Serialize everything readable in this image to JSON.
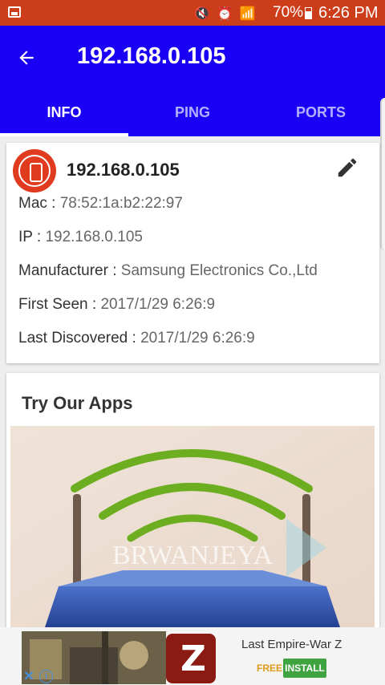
{
  "status_bar": {
    "battery": "70%",
    "time": "6:26 PM",
    "icons": [
      "image-icon",
      "mute-icon",
      "alarm-icon",
      "wifi-icon",
      "signal-icon",
      "battery-icon"
    ]
  },
  "app_bar": {
    "title": "192.168.0.105",
    "back_icon": "arrow-left-icon",
    "tabs": [
      {
        "label": "INFO",
        "selected": true
      },
      {
        "label": "PING",
        "selected": false
      },
      {
        "label": "PORTS",
        "selected": false
      }
    ]
  },
  "device": {
    "title": "192.168.0.105",
    "avatar_icon": "phone-icon",
    "avatar_color": "#e03b1e",
    "edit_icon": "pencil-icon",
    "details": [
      {
        "label": "Mac :",
        "value": "78:52:1a:b2:22:97"
      },
      {
        "label": "IP :",
        "value": "192.168.0.105"
      },
      {
        "label": "Manufacturer :",
        "value": "Samsung Electronics Co.,Ltd"
      },
      {
        "label": "First Seen :",
        "value": "2017/1/29 6:26:9"
      },
      {
        "label": "Last Discovered :",
        "value": "2017/1/29 6:26:9"
      }
    ]
  },
  "apps": {
    "title": "Try Our Apps",
    "banner_watermark": "BRWANJEYA"
  },
  "ad": {
    "app_name": "Last Empire-War Z",
    "price": "FREE",
    "install_label": "INSTALL",
    "close_icon": "close-icon",
    "info_icon": "info-icon",
    "info_symbol": "i",
    "game_icon_letter": "Z"
  },
  "colors": {
    "status_bar": "#cc3d1a",
    "app_bar": "#1a00f5",
    "install_button": "#3fa33f"
  }
}
